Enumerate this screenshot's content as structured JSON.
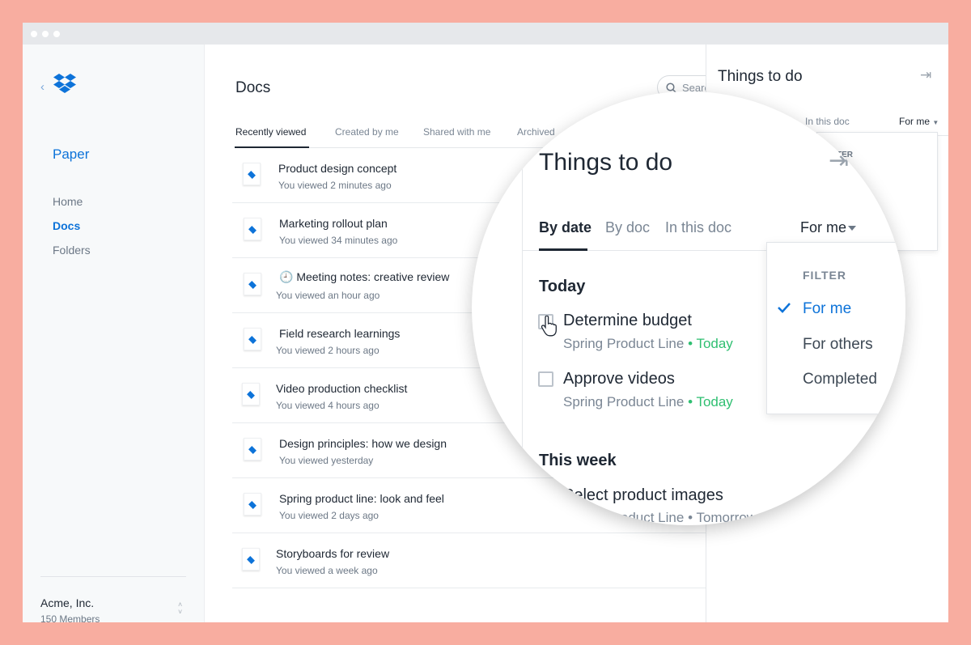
{
  "colors": {
    "background": "#f8ada0",
    "brand_blue": "#0d73d9",
    "due_green": "#2fbf71",
    "sidebar_bg": "#f7f9fa"
  },
  "sidebar": {
    "back_icon": "chevron-left-icon",
    "logo_icon": "dropbox-logo-icon",
    "app_name": "Paper",
    "nav": [
      {
        "label": "Home",
        "active": false
      },
      {
        "label": "Docs",
        "active": true
      },
      {
        "label": "Folders",
        "active": false
      }
    ],
    "org": {
      "name": "Acme, Inc.",
      "members": "150 Members"
    }
  },
  "main": {
    "title": "Docs",
    "search_placeholder": "Search",
    "tabs": [
      {
        "label": "Recently viewed",
        "active": true
      },
      {
        "label": "Created by me",
        "active": false
      },
      {
        "label": "Shared with me",
        "active": false
      },
      {
        "label": "Archived",
        "active": false
      }
    ],
    "docs": [
      {
        "title": "Product design concept",
        "viewed": "You viewed 2 minutes ago"
      },
      {
        "title": "Marketing rollout plan",
        "viewed": "You viewed 34 minutes ago"
      },
      {
        "title": "🕘 Meeting notes: creative review",
        "viewed": "You viewed an hour ago"
      },
      {
        "title": "Field research learnings",
        "viewed": "You viewed 2 hours ago"
      },
      {
        "title": "Video production checklist",
        "viewed": "You viewed 4 hours ago"
      },
      {
        "title": "Design principles: how we design",
        "viewed": "You viewed yesterday"
      },
      {
        "title": "Spring product line: look and feel",
        "viewed": "You viewed 2 days ago"
      },
      {
        "title": "Storyboards for review",
        "viewed": "You viewed a week ago"
      }
    ]
  },
  "panel": {
    "title": "Things to do",
    "close_icon": "collapse-right-icon",
    "tab_in_doc": "In this doc",
    "filter_label": "For me",
    "dropdown_fragment": "TER"
  },
  "lens": {
    "title": "Things to do",
    "tabs": [
      {
        "label": "By date",
        "active": true
      },
      {
        "label": "By doc",
        "active": false
      },
      {
        "label": "In this doc",
        "active": false
      }
    ],
    "filter_label": "For me",
    "sections": [
      {
        "heading": "Today",
        "tasks": [
          {
            "title": "Determine budget",
            "doc": "Spring Product Line",
            "sep": "•",
            "due": "Today"
          },
          {
            "title": "Approve videos",
            "doc": "Spring Product Line",
            "sep": "•",
            "due": "Today"
          }
        ]
      },
      {
        "heading": "This week",
        "tasks": [
          {
            "title": "Select product images",
            "doc": "Spring Product Line",
            "sep": "•",
            "due": "Tomorrow"
          }
        ]
      }
    ],
    "dropdown": {
      "header": "FILTER",
      "items": [
        {
          "label": "For me",
          "selected": true
        },
        {
          "label": "For others",
          "selected": false
        },
        {
          "label": "Completed",
          "selected": false
        }
      ]
    }
  }
}
